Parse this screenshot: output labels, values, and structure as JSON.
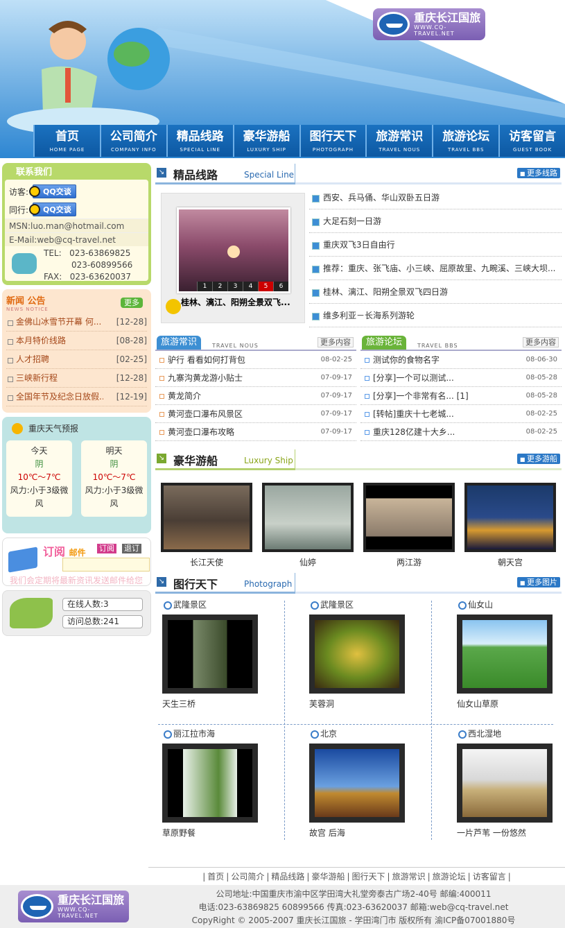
{
  "brand": {
    "name": "重庆长江国旅",
    "url": "WWW.CQ-TRAVEL.NET"
  },
  "nav": [
    {
      "cn": "首页",
      "en": "HOME PAGE"
    },
    {
      "cn": "公司简介",
      "en": "COMPANY INFO"
    },
    {
      "cn": "精品线路",
      "en": "SPECIAL LINE"
    },
    {
      "cn": "豪华游船",
      "en": "LUXURY SHIP"
    },
    {
      "cn": "图行天下",
      "en": "PHOTOGRAPH"
    },
    {
      "cn": "旅游常识",
      "en": "TRAVEL NOUS"
    },
    {
      "cn": "旅游论坛",
      "en": "TRAVEL BBS"
    },
    {
      "cn": "访客留言",
      "en": "GUEST BOOK"
    }
  ],
  "contact": {
    "title": "联系我们",
    "visitor": "访客:",
    "peer": "同行:",
    "qq": "QQ交谈",
    "msn": "MSN:luo.man@hotmail.com",
    "email": "E-Mail:web@cq-travel.net",
    "tel_label": "TEL:",
    "tel1": "023-63869825",
    "tel2": "023-60899566",
    "fax_label": "FAX:",
    "fax": "023-63620037"
  },
  "news": {
    "title": "新闻 公告",
    "en": "NEWS NOTICE",
    "more": "更多",
    "items": [
      {
        "t": "金佛山冰雪节开幕 何...",
        "d": "[12-28]"
      },
      {
        "t": "本月特价线路",
        "d": "[08-28]"
      },
      {
        "t": "人才招聘",
        "d": "[02-25]"
      },
      {
        "t": "三峡新行程",
        "d": "[12-28]"
      },
      {
        "t": "全国年节及纪念日放假...",
        "d": "[12-19]"
      }
    ]
  },
  "weather": {
    "title": "重庆天气预报",
    "days": [
      {
        "day": "今天",
        "w": "阴",
        "t": "10℃～7℃",
        "wind1": "风力:小于3级微",
        "wind2": "风"
      },
      {
        "day": "明天",
        "w": "阴",
        "t": "10℃～7℃",
        "wind1": "风力:小于3级微",
        "wind2": "风"
      }
    ]
  },
  "subscribe": {
    "title": "订阅",
    "title2": "邮件",
    "btn1": "订阅",
    "btn2": "退订",
    "tip": "我们会定期将最新资讯发送邮件给您"
  },
  "stats": {
    "online": "在线人数:3",
    "visits": "访问总数:241"
  },
  "special": {
    "cn": "精品线路",
    "en": "Special Line",
    "more": "更多线路",
    "caption": "桂林、漓江、阳朔全景双飞...",
    "nums": [
      "1",
      "2",
      "3",
      "4",
      "5",
      "6"
    ],
    "items": [
      "西安、兵马俑、华山双卧五日游",
      "大足石刻一日游",
      "重庆双飞3日自由行",
      "推荐：重庆、张飞庙、小三峡、屈原故里、九畹溪、三峡大坝...",
      "桂林、漓江、阳朔全景双飞四日游",
      "维多利亚－长海系列游轮"
    ]
  },
  "nous": {
    "title": "旅游常识",
    "en": "TRAVEL NOUS",
    "more": "更多内容",
    "items": [
      {
        "t": "驴行 看看如何打背包",
        "d": "08-02-25"
      },
      {
        "t": "九寨沟黄龙游小贴士",
        "d": "07-09-17"
      },
      {
        "t": "黄龙简介",
        "d": "07-09-17"
      },
      {
        "t": "黄河壶口瀑布风景区",
        "d": "07-09-17"
      },
      {
        "t": "黄河壶口瀑布攻略",
        "d": "07-09-17"
      }
    ]
  },
  "bbs": {
    "title": "旅游论坛",
    "en": "TRAVEL BBS",
    "more": "更多内容",
    "items": [
      {
        "t": "测试你的食物名字",
        "d": "08-06-30"
      },
      {
        "t": "[分享]一个可以测试...",
        "d": "08-05-28"
      },
      {
        "t": "[分享]一个非常有名... [1]",
        "d": "08-05-28"
      },
      {
        "t": "[转帖]重庆十七老城...",
        "d": "08-02-25"
      },
      {
        "t": "重庆128亿建十大乡...",
        "d": "08-02-25"
      }
    ]
  },
  "ships": {
    "cn": "豪华游船",
    "en": "Luxury Ship",
    "more": "更多游船",
    "items": [
      "长江天使",
      "仙婷",
      "两江游",
      "朝天宫"
    ]
  },
  "photos": {
    "cn": "图行天下",
    "en": "Photograph",
    "more": "更多图片",
    "items": [
      {
        "place": "武隆景区",
        "cap": "天生三桥"
      },
      {
        "place": "武隆景区",
        "cap": "芙蓉洞"
      },
      {
        "place": "仙女山",
        "cap": "仙女山草原"
      },
      {
        "place": "丽江拉市海",
        "cap": "草原野餐"
      },
      {
        "place": "北京",
        "cap": "故宫 后海"
      },
      {
        "place": "西北湿地",
        "cap": "一片芦苇 一份悠然"
      }
    ]
  },
  "footer_nav": [
    "首页",
    "公司简介",
    "精品线路",
    "豪华游船",
    "图行天下",
    "旅游常识",
    "旅游论坛",
    "访客留言"
  ],
  "footer": {
    "addr": "公司地址:中国重庆市渝中区学田湾大礼堂旁泰古广场2-40号 邮编:400011",
    "contact": "电话:023-63869825 60899566 传真:023-63620037 邮箱:web@cq-travel.net",
    "copy": "CopyRight © 2005-2007 重庆长江国旅 - 学田湾门市 版权所有 渝ICP备07001880号"
  }
}
